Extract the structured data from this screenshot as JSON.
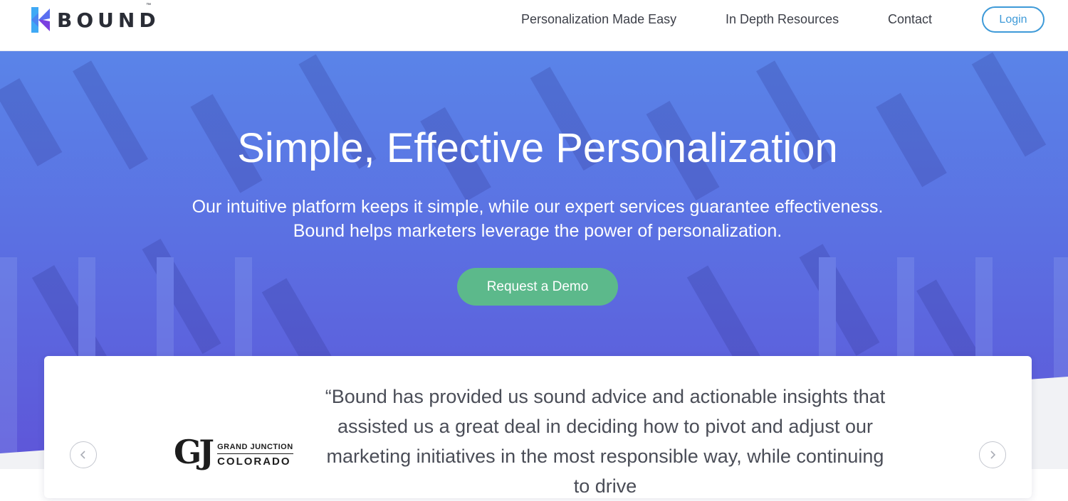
{
  "header": {
    "brand": "BOUND",
    "trademark": "™",
    "nav": [
      {
        "label": "Personalization Made Easy"
      },
      {
        "label": "In Depth Resources"
      },
      {
        "label": "Contact"
      }
    ],
    "login_label": "Login"
  },
  "hero": {
    "title": "Simple, Effective Personalization",
    "subtitle_line1": "Our intuitive platform keeps it simple, while our expert services guarantee effectiveness.",
    "subtitle_line2": "Bound helps marketers leverage the power of personalization.",
    "cta_label": "Request a Demo"
  },
  "testimonial": {
    "quote_lines": [
      "“Bound has provided us sound advice and actionable insights that",
      "assisted us a great deal in deciding how to pivot and adjust our",
      "marketing initiatives in the most responsible way, while continuing to drive"
    ],
    "logo": {
      "mark": "GJ",
      "line1": "GRAND JUNCTION",
      "line2": "COLORADO"
    },
    "prev_icon": "chevron-left-icon",
    "next_icon": "chevron-right-icon"
  },
  "colors": {
    "accent_blue": "#3e9ad8",
    "cta_green": "#5cb98b",
    "hero_top": "#5a84e8",
    "hero_bottom": "#5e55d8"
  }
}
